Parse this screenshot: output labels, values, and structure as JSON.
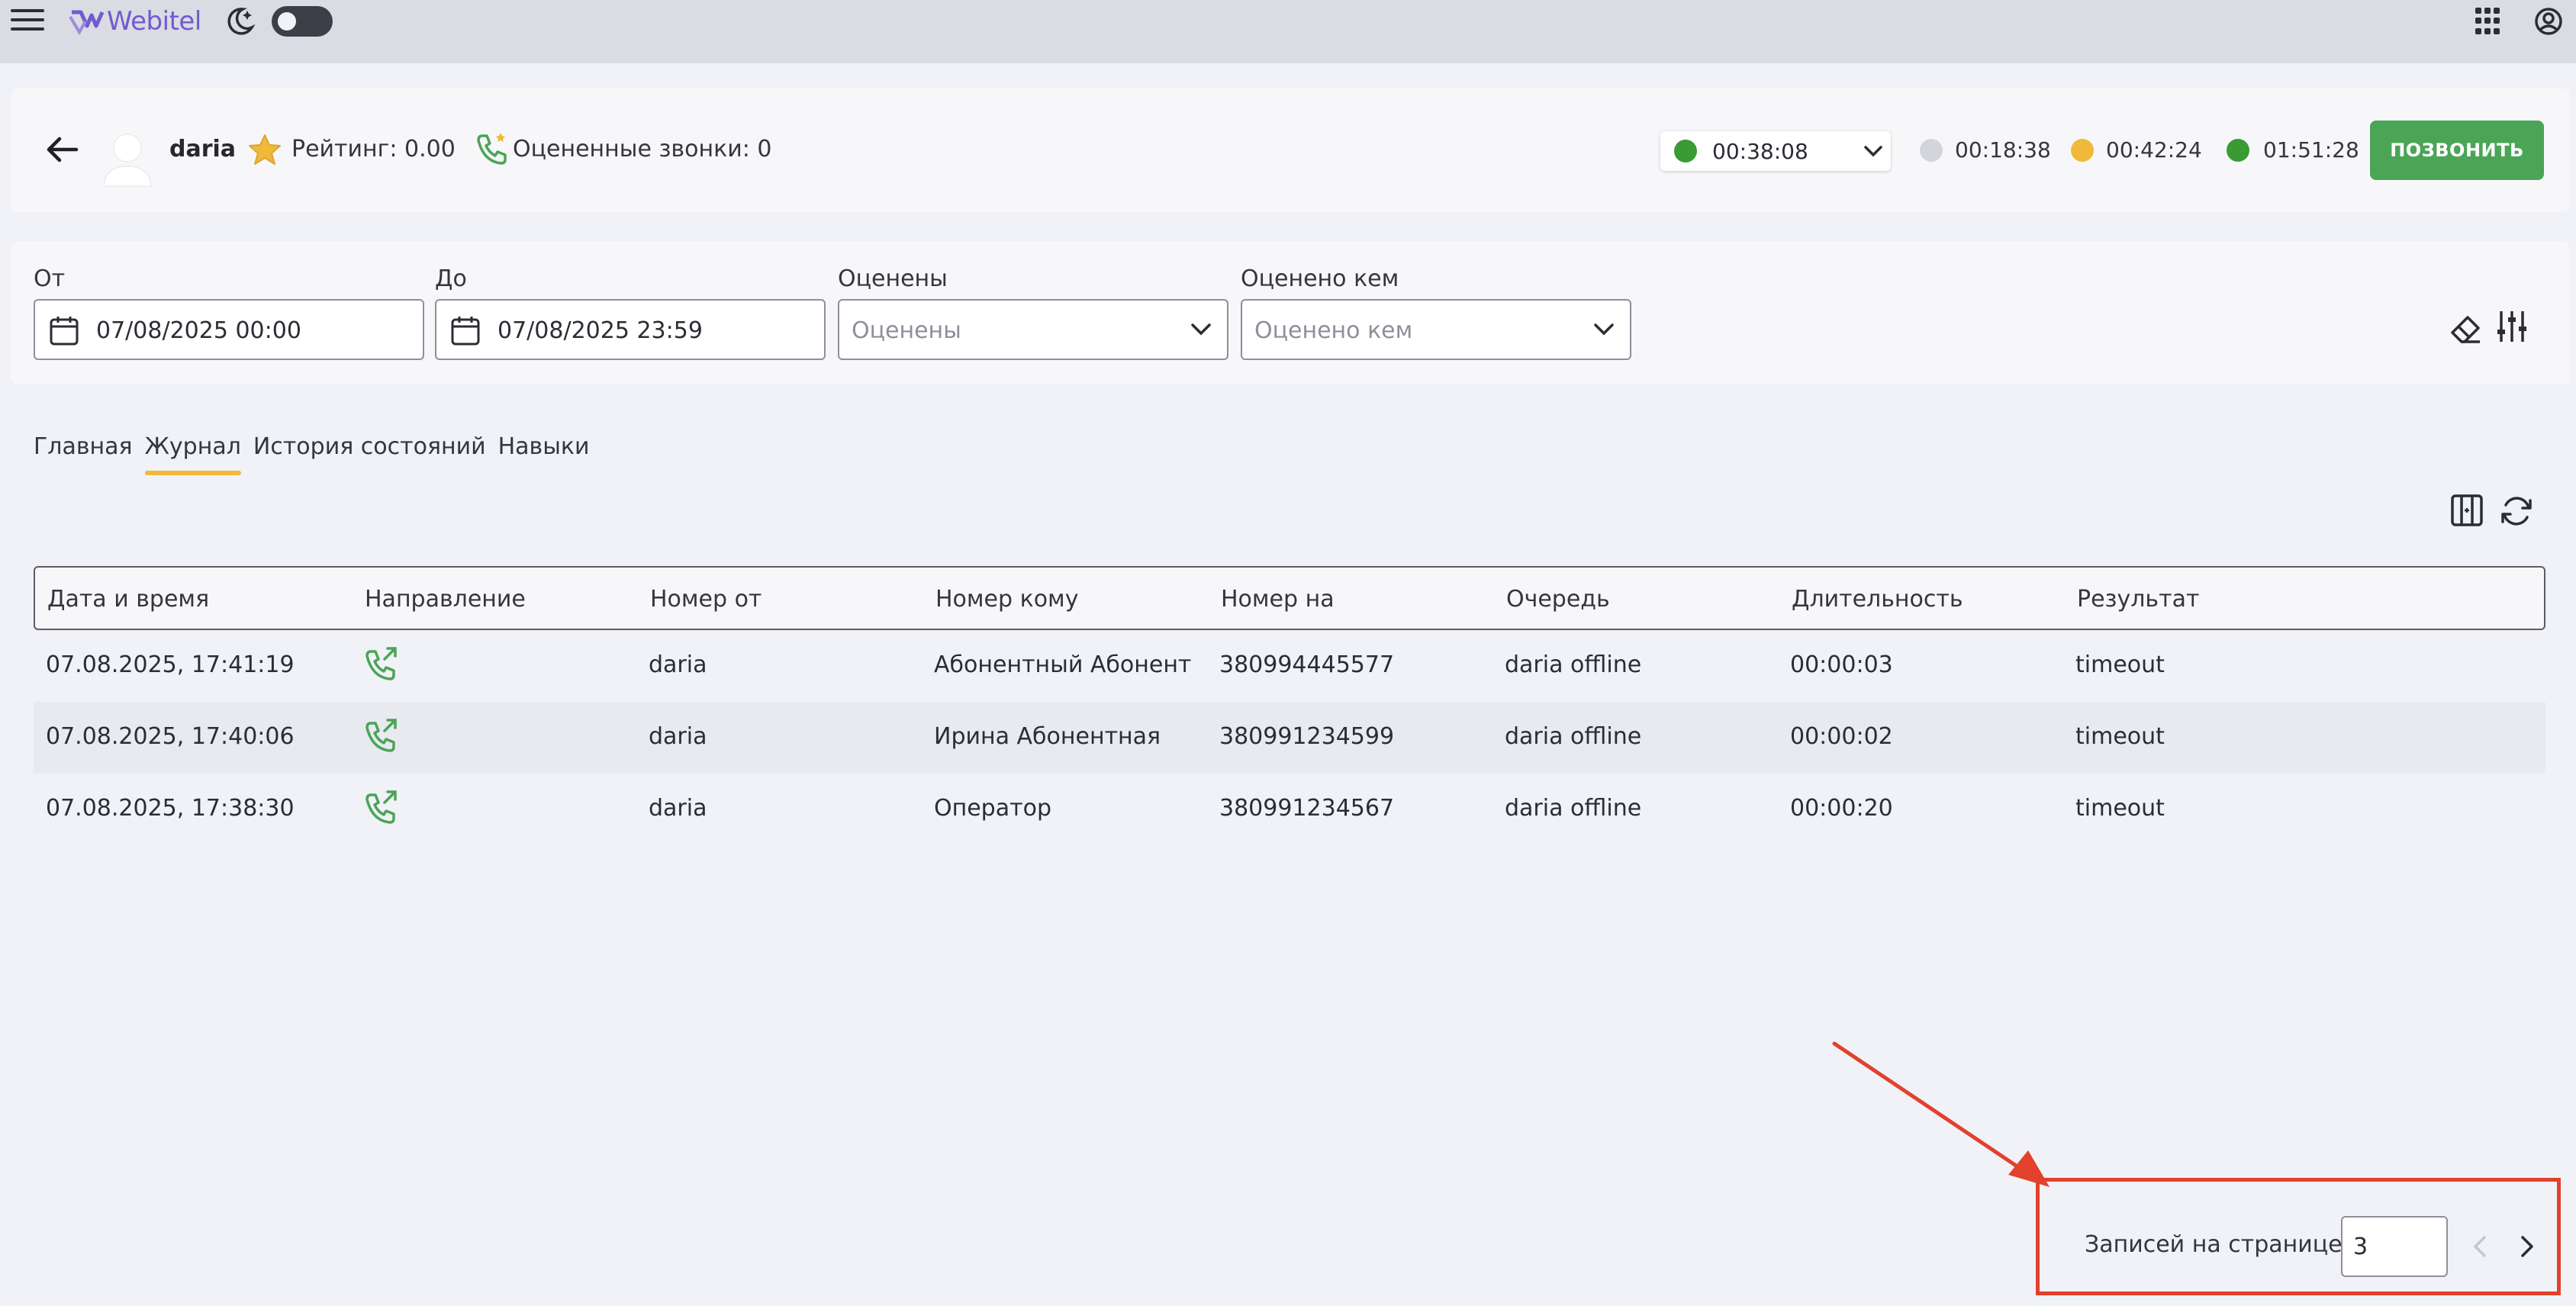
{
  "app": {
    "name": "Webitel"
  },
  "agent": {
    "name": "daria",
    "rating_label": "Рейтинг: 0.00",
    "rated_calls_label": "Оцененные звонки: 0"
  },
  "status": {
    "current_time": "00:38:08",
    "current_color": "#3a9b35",
    "timers": [
      {
        "value": "00:18:38",
        "color": "#d4d5da"
      },
      {
        "value": "00:42:24",
        "color": "#f0b93a"
      },
      {
        "value": "01:51:28",
        "color": "#3a9b35"
      }
    ],
    "call_button": "ПОЗВОНИТЬ"
  },
  "filters": {
    "from": {
      "label": "От",
      "value": "07/08/2025 00:00"
    },
    "to": {
      "label": "До",
      "value": "07/08/2025 23:59"
    },
    "rated": {
      "label": "Оценены",
      "placeholder": "Оценены"
    },
    "rated_by": {
      "label": "Оценено кем",
      "placeholder": "Оценено кем"
    }
  },
  "tabs": [
    "Главная",
    "Журнал",
    "История состояний",
    "Навыки"
  ],
  "active_tab": "Журнал",
  "table": {
    "headers": [
      "Дата и время",
      "Направление",
      "Номер от",
      "Номер кому",
      "Номер на",
      "Очередь",
      "Длительность",
      "Результат"
    ],
    "rows": [
      {
        "datetime": "07.08.2025, 17:41:19",
        "direction": "outbound-call-icon",
        "from": "daria",
        "to": "Абонентный Абонент",
        "number": "380994445577",
        "queue": "daria offline",
        "duration": "00:00:03",
        "result": "timeout"
      },
      {
        "datetime": "07.08.2025, 17:40:06",
        "direction": "outbound-call-icon",
        "from": "daria",
        "to": "Ирина Абонентная",
        "number": "380991234599",
        "queue": "daria offline",
        "duration": "00:00:02",
        "result": "timeout"
      },
      {
        "datetime": "07.08.2025, 17:38:30",
        "direction": "outbound-call-icon",
        "from": "daria",
        "to": "Оператор",
        "number": "380991234567",
        "queue": "daria offline",
        "duration": "00:00:20",
        "result": "timeout"
      }
    ]
  },
  "pagination": {
    "per_page_label": "Записей на странице:",
    "per_page_value": "3"
  },
  "colors": {
    "accent_green": "#4aa556",
    "tab_underline": "#f0b93a",
    "annotation_red": "#e2412c",
    "brand_purple": "#6e5ccf"
  }
}
